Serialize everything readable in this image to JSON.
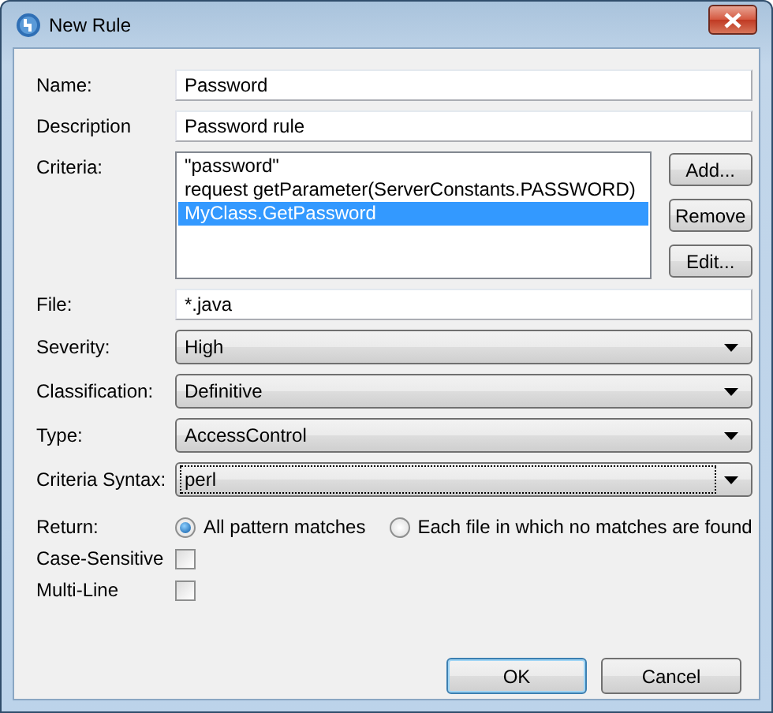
{
  "window": {
    "title": "New Rule"
  },
  "fields": [
    {
      "label": "Name:",
      "value": "Password"
    },
    {
      "label": "Description",
      "value": "Password rule"
    }
  ],
  "criteria": {
    "label": "Criteria:",
    "items": [
      {
        "text": "\"password\"",
        "selected": false
      },
      {
        "text": "request getParameter(ServerConstants.PASSWORD)",
        "selected": false
      },
      {
        "text": "MyClass.GetPassword",
        "selected": true
      }
    ],
    "buttons": [
      {
        "label": "Add..."
      },
      {
        "label": "Remove"
      },
      {
        "label": "Edit..."
      }
    ]
  },
  "file": {
    "label": "File:",
    "value": "*.java"
  },
  "dropdowns": [
    {
      "label": "Severity:",
      "value": "High",
      "focused": false
    },
    {
      "label": "Classification:",
      "value": "Definitive",
      "focused": false
    },
    {
      "label": "Type:",
      "value": "AccessControl",
      "focused": false
    },
    {
      "label": "Criteria Syntax:",
      "value": "perl",
      "focused": true
    }
  ],
  "return": {
    "label": "Return:",
    "options": [
      {
        "label": "All pattern matches",
        "selected": true
      },
      {
        "label": "Each file in which no matches are found",
        "selected": false
      }
    ]
  },
  "checkboxes": [
    {
      "label": "Case-Sensitive",
      "checked": false
    },
    {
      "label": "Multi-Line",
      "checked": false
    }
  ],
  "buttons": [
    {
      "label": "OK",
      "default": true
    },
    {
      "label": "Cancel",
      "default": false
    }
  ]
}
